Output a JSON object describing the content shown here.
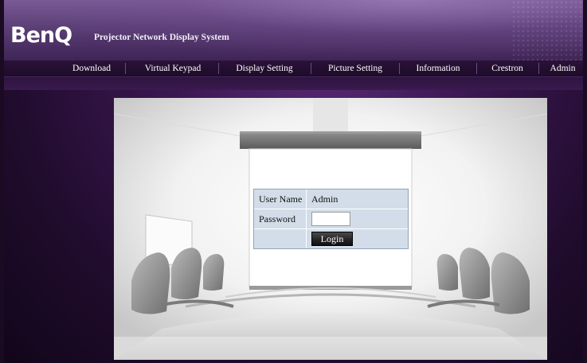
{
  "brand": {
    "logo_text": "BenQ",
    "product_name": "Projector Network Display System"
  },
  "nav": {
    "items": [
      {
        "label": "Download"
      },
      {
        "label": "Virtual Keypad"
      },
      {
        "label": "Display Setting"
      },
      {
        "label": "Picture Setting"
      },
      {
        "label": "Information"
      },
      {
        "label": "Crestron"
      },
      {
        "label": "Admin"
      }
    ]
  },
  "login": {
    "username_label": "User Name",
    "username_value": "Admin",
    "password_label": "Password",
    "password_value": "",
    "login_button": "Login"
  },
  "colors": {
    "brand_purple": "#3b1752",
    "nav_bg": "#1e0b29",
    "form_cell": "#d2dde9"
  }
}
